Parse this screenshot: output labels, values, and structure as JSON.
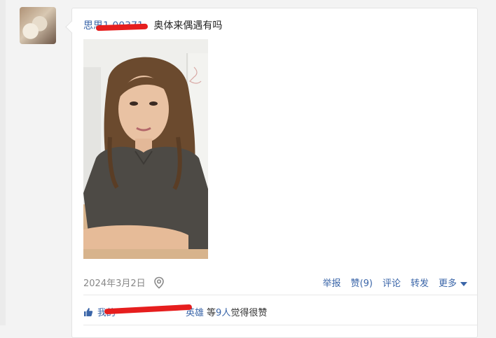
{
  "post": {
    "username": "思思1 00371",
    "text": "奥体来偶遇有吗",
    "date": "2024年3月2日",
    "actions": {
      "report": "举报",
      "like": "赞(9)",
      "comment": "评论",
      "repost": "转发",
      "more": "更多"
    },
    "likes": {
      "liker_prefix": "我的",
      "liker_name": "英雄",
      "middle": "等",
      "count": "9人",
      "suffix": "觉得很赞"
    }
  },
  "icons": {
    "location": "location-pin-icon",
    "like": "thumbs-up-icon",
    "more": "caret-down-icon"
  },
  "colors": {
    "link": "#3a65a8",
    "redaction": "#e61e1e"
  }
}
